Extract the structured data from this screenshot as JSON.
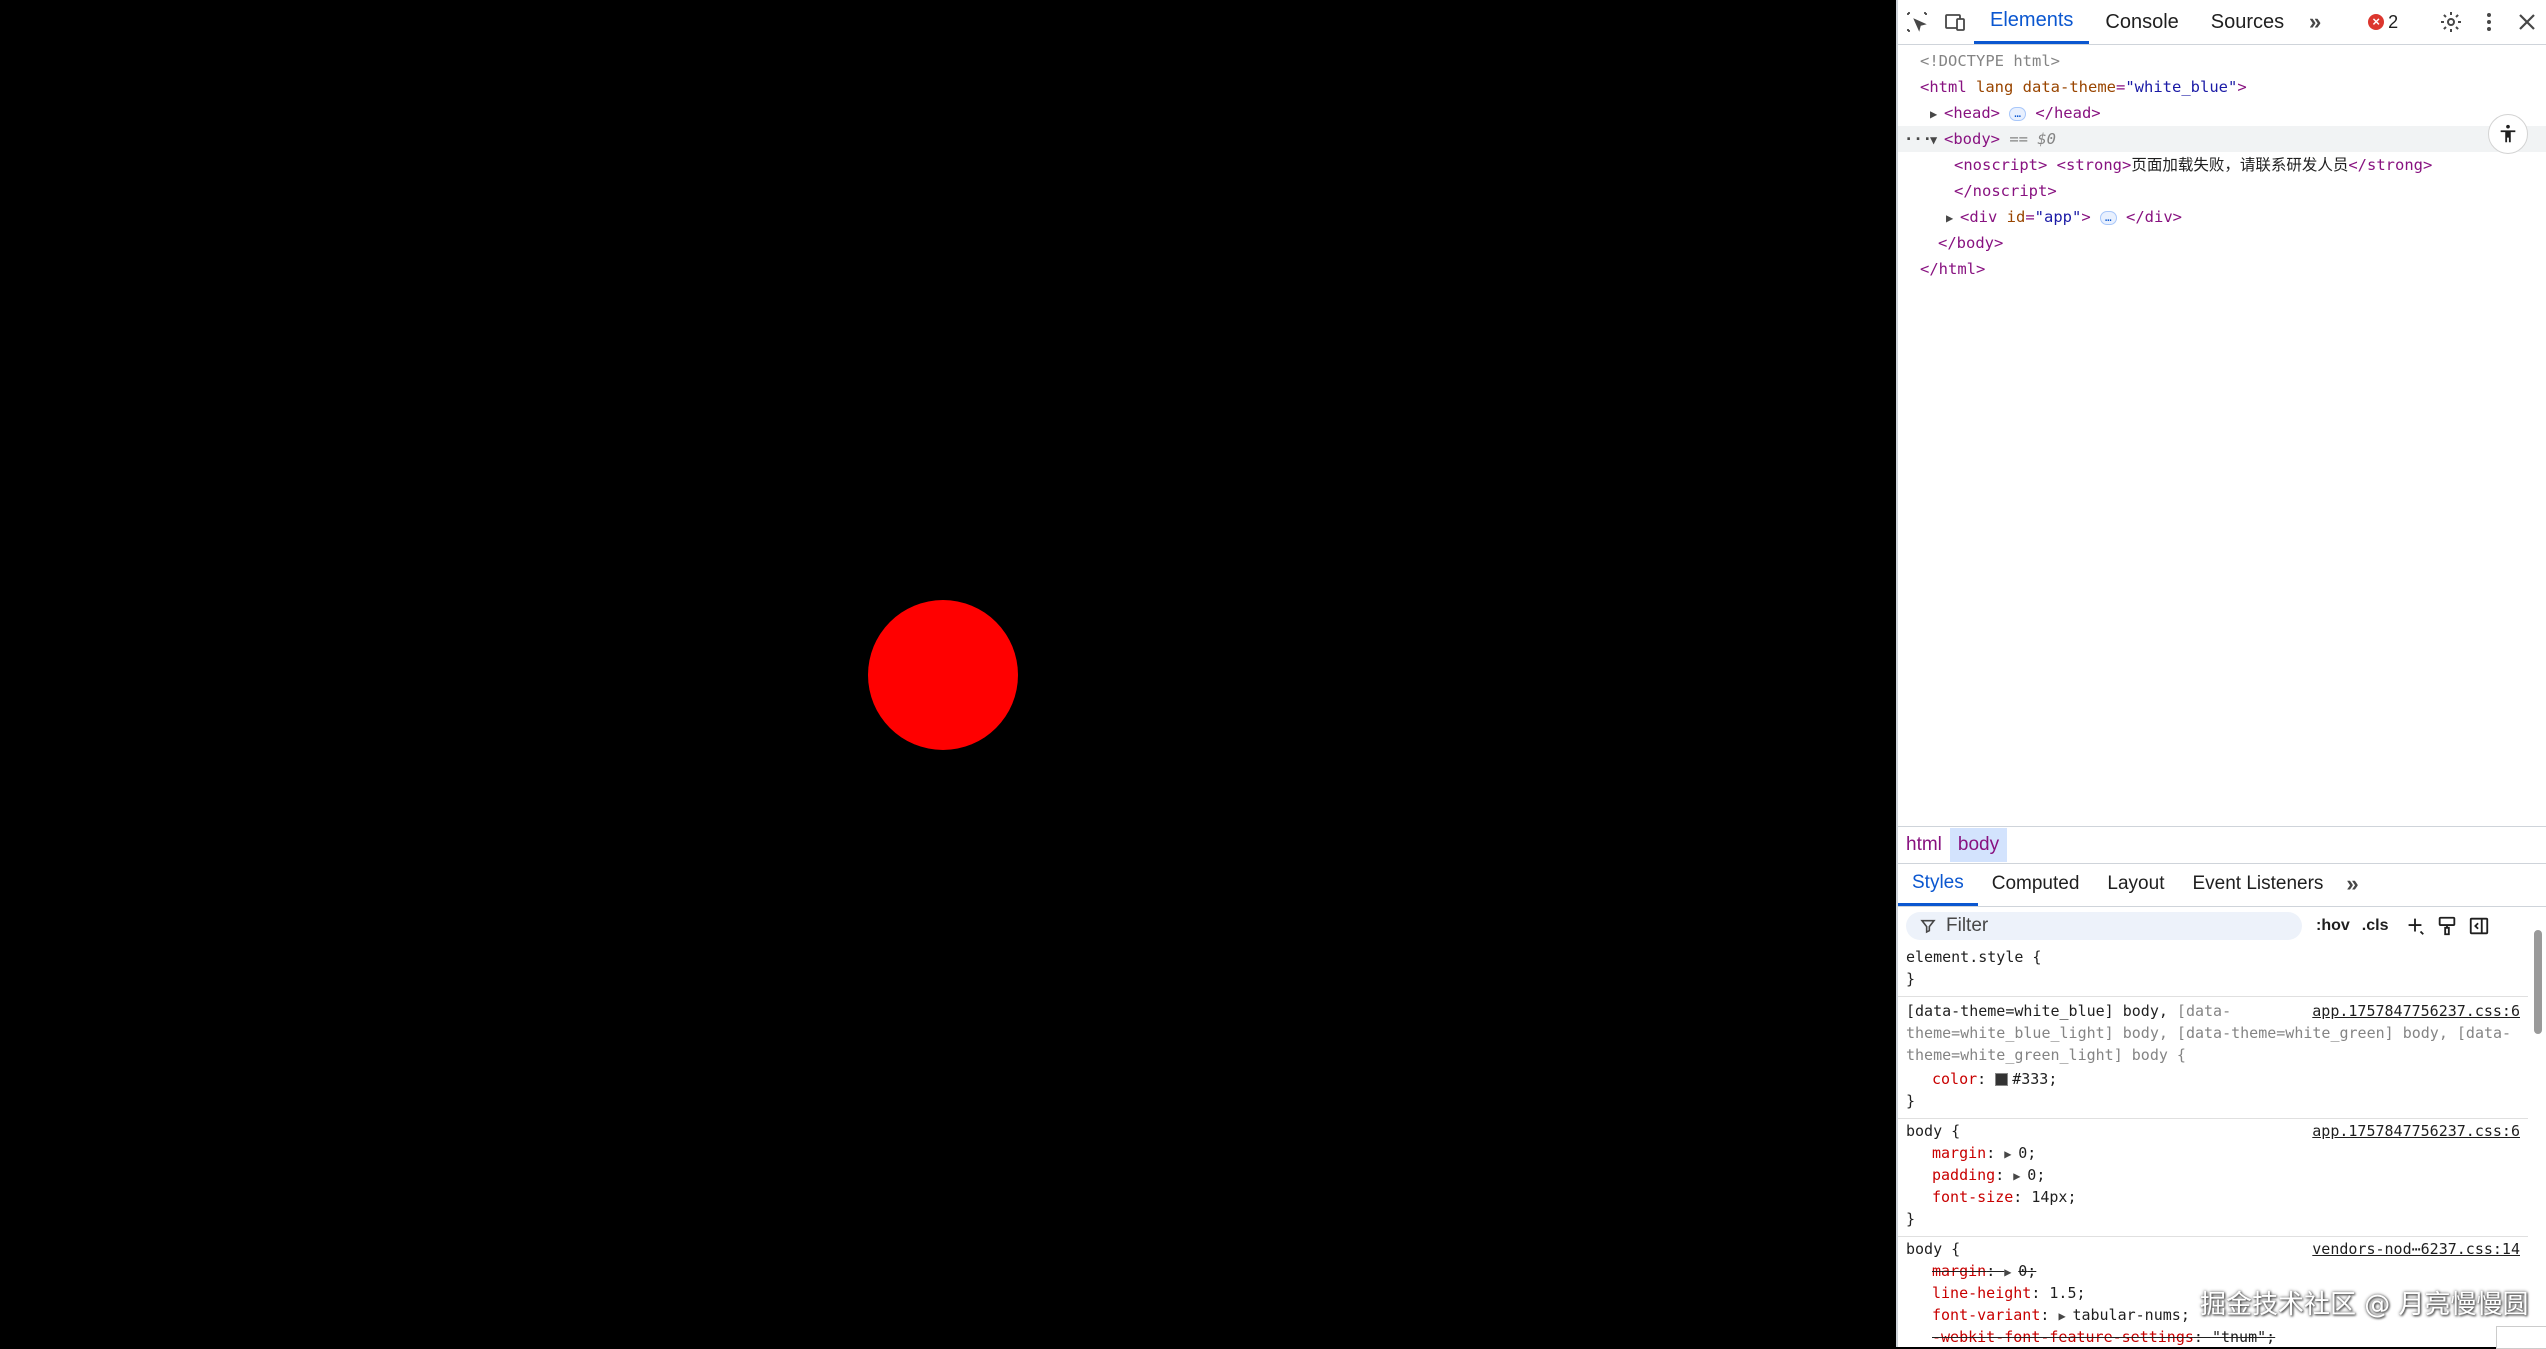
{
  "page": {
    "background": "#000000",
    "ball_color": "#ff0000"
  },
  "devtools": {
    "tabs": [
      {
        "label": "Elements",
        "active": true
      },
      {
        "label": "Console",
        "active": false
      },
      {
        "label": "Sources",
        "active": false
      }
    ],
    "error_count": "2",
    "dom": {
      "doctype": "<!DOCTYPE html>",
      "html_open_tag": "<html",
      "html_attr_lang": " lang",
      "html_attr_theme_name": " data-theme",
      "html_attr_theme_value": "\"white_blue\"",
      "close_angle": ">",
      "head_open": "<head>",
      "head_close": "</head>",
      "ellipsis": "…",
      "body_open": "<body>",
      "body_eq": " == $0",
      "noscript_open": "<noscript>",
      "strong_open": "<strong>",
      "noscript_text": "页面加载失败，请联系研发人员",
      "strong_close": "</strong>",
      "noscript_close": "</noscript>",
      "div_open": "<div",
      "div_attr_name": " id",
      "div_attr_value": "\"app\"",
      "div_close": "</div>",
      "body_close": "</body>",
      "html_close": "</html>"
    },
    "breadcrumbs": [
      {
        "label": "html",
        "active": false
      },
      {
        "label": "body",
        "active": true
      }
    ],
    "subtabs": [
      {
        "label": "Styles",
        "active": true
      },
      {
        "label": "Computed",
        "active": false
      },
      {
        "label": "Layout",
        "active": false
      },
      {
        "label": "Event Listeners",
        "active": false
      }
    ],
    "filter": {
      "placeholder": "Filter",
      "hov": ":hov",
      "cls": ".cls"
    },
    "styles": {
      "element_style": "element.style {",
      "close_brace": "}",
      "rule1": {
        "selector_line1_a": "[data-theme=white_blue] body,",
        "selector_line1_b": " [data-",
        "selector_line2": "theme=white_blue_light] body, [data-theme=white_green] body, [data-",
        "selector_line3": "theme=white_green_light] body {",
        "source": "app.1757847756237.css:6",
        "prop": "color",
        "value": "#333",
        "swatch": "#333333"
      },
      "rule2": {
        "selector": "body {",
        "source": "app.1757847756237.css:6",
        "props": [
          {
            "name": "margin",
            "value": "0"
          },
          {
            "name": "padding",
            "value": "0"
          },
          {
            "name": "font-size",
            "value": "14px"
          }
        ]
      },
      "rule3": {
        "selector": "body {",
        "source": "vendors-nod⋯6237.css:14",
        "props": [
          {
            "name": "margin",
            "value": "0"
          },
          {
            "name": "line-height",
            "value": "1.5"
          },
          {
            "name": "font-variant",
            "value": "tabular-nums"
          },
          {
            "name": "-webkit-font-feature-settings",
            "value": "\"tnum\""
          }
        ]
      }
    }
  },
  "watermark": "掘金技术社区 @ 月亮慢慢圆"
}
